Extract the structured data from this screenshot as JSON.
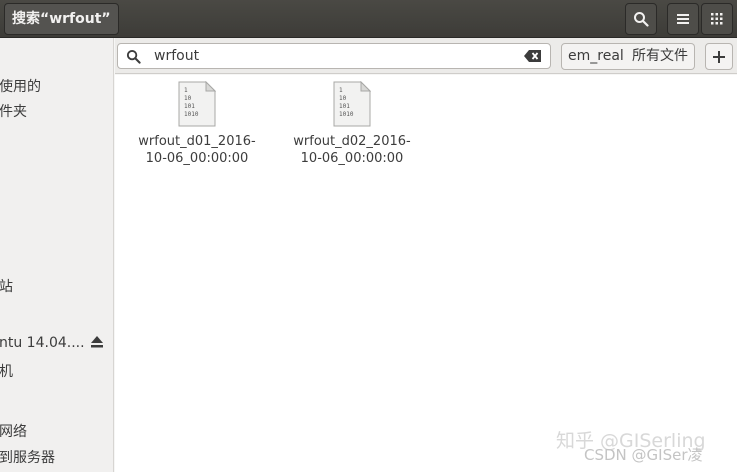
{
  "header": {
    "title": "搜索“wrfout”",
    "search_button_icon": "search-icon",
    "list_view_icon": "list-view-icon",
    "grid_view_icon": "grid-view-icon"
  },
  "search": {
    "query": "wrfout",
    "location_filter": "em_real",
    "type_filter": "所有文件",
    "add_label": "+"
  },
  "sidebar": {
    "items": [
      {
        "label": "使用的"
      },
      {
        "label": "件夹"
      },
      {
        "label": "站"
      },
      {
        "label": "ntu 14.04...."
      },
      {
        "label": "机"
      },
      {
        "label": "网络"
      },
      {
        "label": "到服务器"
      }
    ]
  },
  "files": [
    {
      "name_line1": "wrfout_d01_2016-",
      "name_line2": "10-06_00:00:00"
    },
    {
      "name_line1": "wrfout_d02_2016-",
      "name_line2": "10-06_00:00:00"
    }
  ],
  "watermark": {
    "line1": "知乎 @GISerling",
    "line2": "CSDN @GISer凌"
  }
}
